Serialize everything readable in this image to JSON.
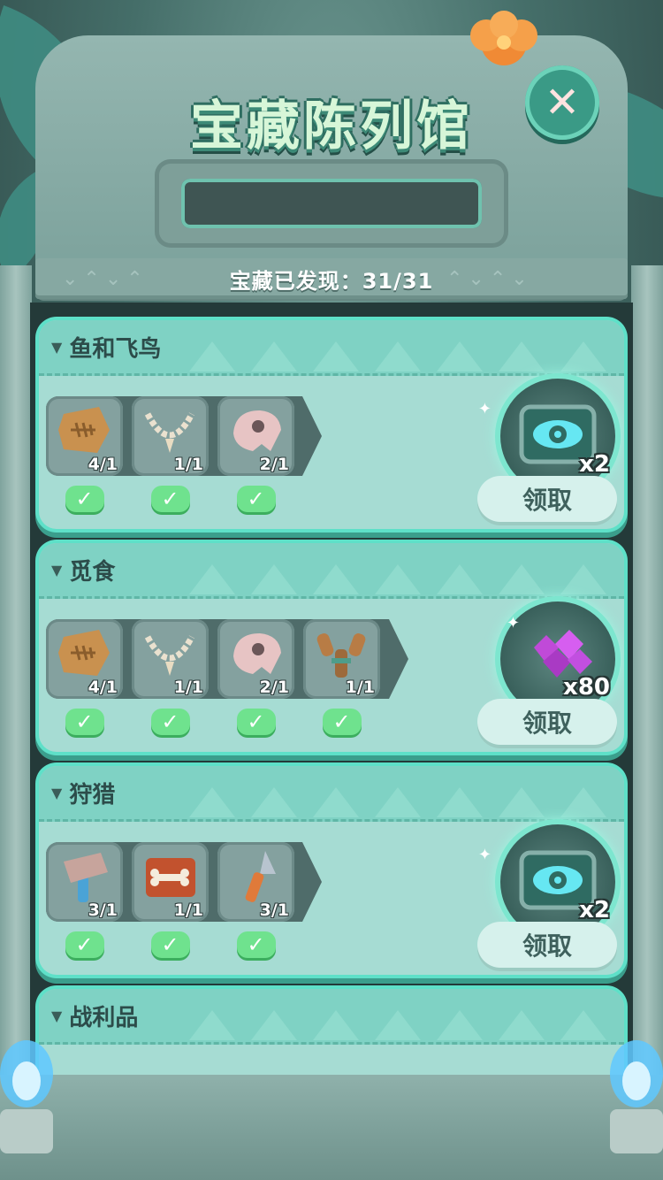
{
  "header": {
    "title": "宝藏陈列馆",
    "counter_label": "宝藏已发现：31/31",
    "close_icon": "close-x-icon"
  },
  "colors": {
    "accent": "#5ee0c8",
    "card_bg": "#a6dcd3",
    "check": "#6fe28e",
    "claim_bg": "#d6f1ec"
  },
  "collections": [
    {
      "name": "鱼和飞鸟",
      "items": [
        {
          "icon": "fish-fossil-icon",
          "count": "4/1"
        },
        {
          "icon": "bone-necklace-icon",
          "count": "1/1"
        },
        {
          "icon": "bird-skull-icon",
          "count": "2/1"
        }
      ],
      "reward": {
        "icon": "eye-rune-card-icon",
        "count": "x2"
      },
      "claim_label": "领取"
    },
    {
      "name": "觅食",
      "items": [
        {
          "icon": "fish-fossil-icon",
          "count": "4/1"
        },
        {
          "icon": "bone-necklace-icon",
          "count": "1/1"
        },
        {
          "icon": "bird-skull-icon",
          "count": "2/1"
        },
        {
          "icon": "slingshot-icon",
          "count": "1/1"
        }
      ],
      "reward": {
        "icon": "purple-gem-icon",
        "count": "x80"
      },
      "claim_label": "领取"
    },
    {
      "name": "狩猎",
      "items": [
        {
          "icon": "stone-hammer-icon",
          "count": "3/1"
        },
        {
          "icon": "bone-plate-icon",
          "count": "1/1"
        },
        {
          "icon": "stone-spear-icon",
          "count": "3/1"
        }
      ],
      "reward": {
        "icon": "eye-rune-card-icon",
        "count": "x2"
      },
      "claim_label": "领取"
    },
    {
      "name": "战利品",
      "items": [],
      "reward": null,
      "claim_label": ""
    }
  ]
}
